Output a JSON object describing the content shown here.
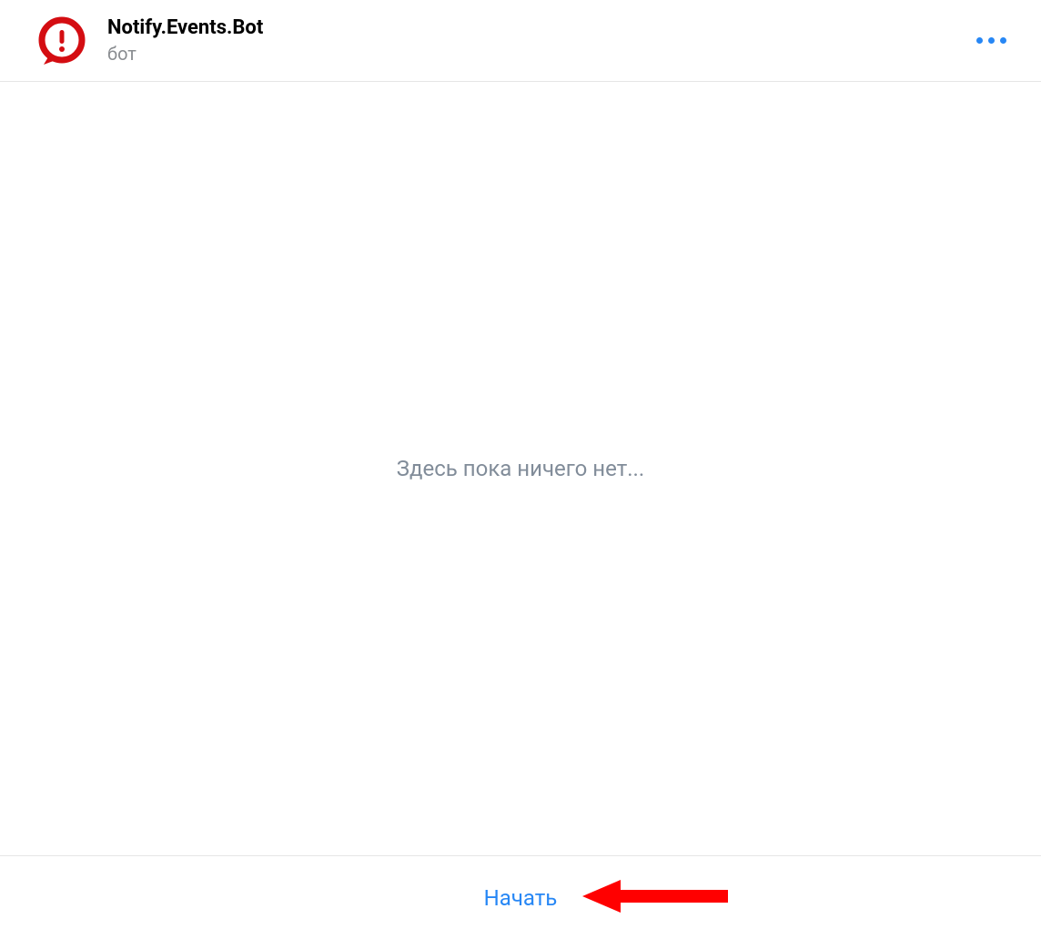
{
  "header": {
    "title": "Notify.Events.Bot",
    "subtitle": "бот",
    "icon": "alert-speech-icon",
    "more_icon": "more-horizontal-icon",
    "colors": {
      "icon_red": "#d40d12",
      "accent_blue": "#2787f5"
    }
  },
  "content": {
    "empty_message": "Здесь пока ничего нет..."
  },
  "footer": {
    "start_label": "Начать"
  },
  "annotation": {
    "arrow": "red-arrow-left"
  }
}
